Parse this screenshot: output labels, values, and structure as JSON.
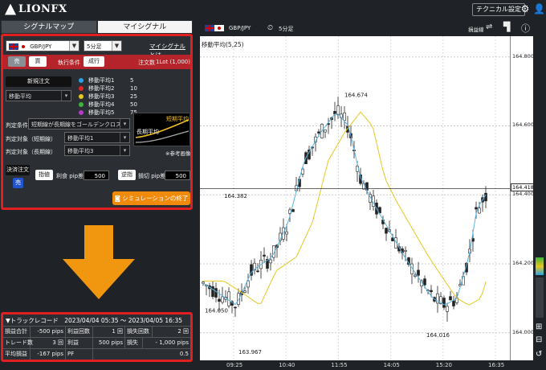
{
  "app": {
    "logo": "LIONFX",
    "tech_settings": "テクニカル設定"
  },
  "tabs": [
    {
      "label": "シグナルマップ"
    },
    {
      "label": "マイシグナル"
    }
  ],
  "config": {
    "pair": "GBP/JPY",
    "interval": "5分足",
    "my_signal_link": "マイシグナルとは",
    "sell": "売",
    "buy": "買",
    "exec_label": "執行条件",
    "exec_value": "成行",
    "order_qty_label": "注文数",
    "order_qty": "1Lot (1,000)",
    "new_order": "新規注文",
    "indicator": "移動平均",
    "moving_averages": [
      {
        "name": "移動平均1",
        "period": "5",
        "color": "#29a3e6"
      },
      {
        "name": "移動平均2",
        "period": "10",
        "color": "#e62222"
      },
      {
        "name": "移動平均3",
        "period": "25",
        "color": "#e6c81e"
      },
      {
        "name": "移動平均4",
        "period": "50",
        "color": "#3cb43c"
      },
      {
        "name": "移動平均5",
        "period": "75",
        "color": "#b43cc8"
      }
    ],
    "judge_label": "判定条件",
    "judge_value": "短期線が長期線をゴールデンクロス",
    "short_label": "判定対象（短期線）",
    "short_value": "移動平均1",
    "long_label": "判定対象（長期線）",
    "long_value": "移動平均3",
    "ref_short": "短期平均",
    "ref_long": "長期平均",
    "ref_note": "※参考画像",
    "settle_label": "決済注文",
    "settle_state": "売",
    "tp_btn": "指値",
    "tp_label": "利食 pip差",
    "tp_value": "500",
    "sl_btn": "逆指",
    "sl_label": "損切 pip差",
    "sl_value": "500",
    "sim_end": "シミュレーションの終了"
  },
  "track": {
    "title": "▼トラックレコード　2023/04/04 05:35 ～ 2023/04/05 16:35",
    "rows": [
      [
        "損益合計",
        "-500 pips",
        "利益回数",
        "1 回",
        "損失回数",
        "2 回"
      ],
      [
        "トレード数",
        "3 回",
        "利益",
        "500 pips",
        "損失",
        "- 1,000 pips"
      ],
      [
        "平均損益",
        "-167 pips",
        "PF",
        "0.5",
        "",
        ""
      ]
    ]
  },
  "chart_header": {
    "pair": "GBP/JPY",
    "interval": "5分足",
    "ma_label_tr": "損益線"
  },
  "chart_data": {
    "type": "candlestick",
    "indicator_label": "移動平均(5,25)",
    "x_ticks": [
      "09:25",
      "10:40",
      "11:55",
      "14:05",
      "15:20",
      "16:35"
    ],
    "y_ticks": [
      "164.800",
      "164.600",
      "164.400",
      "164.200",
      "164.000"
    ],
    "ylim": [
      163.92,
      164.86
    ],
    "annotations": [
      {
        "text": "164.674",
        "value": 164.674
      },
      {
        "text": "164.382",
        "value": 164.382
      },
      {
        "text": "164.050",
        "value": 164.05
      },
      {
        "text": "163.967",
        "value": 163.967
      },
      {
        "text": "164.016",
        "value": 164.016
      }
    ],
    "current_price": "164.418",
    "colors": {
      "ma_short": "#5ab4e6",
      "ma_long": "#e6c81e",
      "candle": "#222222"
    }
  }
}
